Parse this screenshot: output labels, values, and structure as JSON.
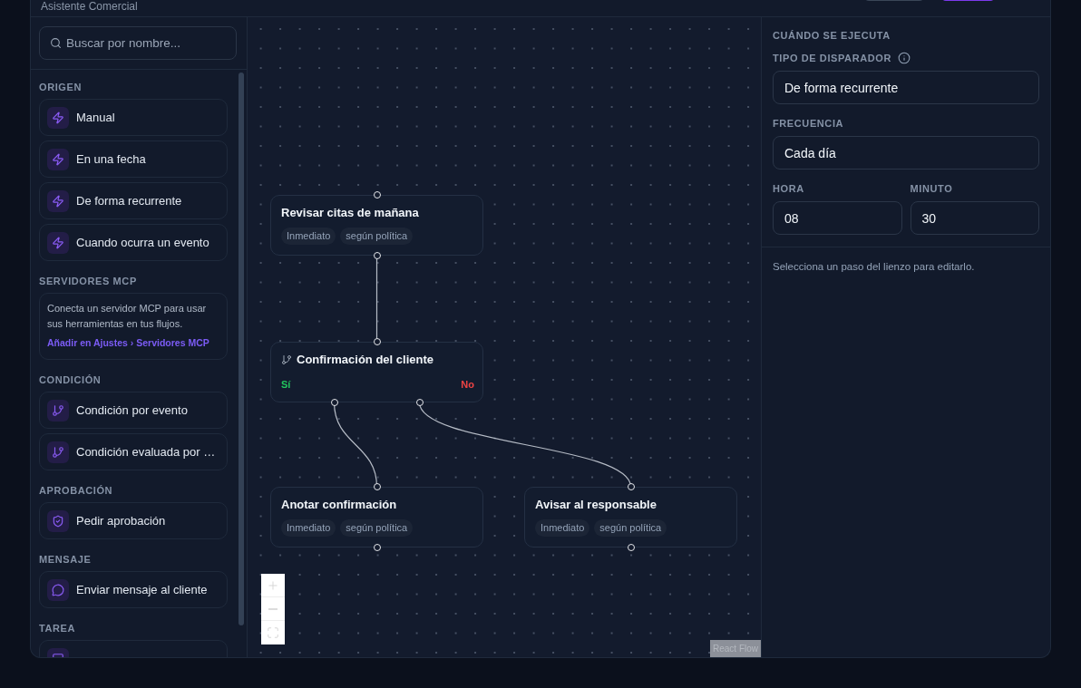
{
  "header": {
    "subtitle": "Asistente Comercial",
    "buttons": [
      {
        "kind": "secondary"
      },
      {
        "kind": "primary"
      }
    ]
  },
  "palette": {
    "search": {
      "placeholder": "Buscar por nombre..."
    },
    "sections": [
      {
        "title": "ORIGEN",
        "items": [
          {
            "kind": "trigger",
            "label": "Manual"
          },
          {
            "kind": "trigger",
            "label": "En una fecha"
          },
          {
            "kind": "trigger",
            "label": "De forma recurrente"
          },
          {
            "kind": "trigger",
            "label": "Cuando ocurra un evento"
          }
        ]
      },
      {
        "title": "SERVIDORES MCP",
        "notice": {
          "text": "Conecta un servidor MCP para usar sus herramientas en tus flujos.",
          "link": "Añadir en Ajustes › Servidores MCP"
        }
      },
      {
        "title": "CONDICIÓN",
        "items": [
          {
            "kind": "condition",
            "label": "Condición por evento"
          },
          {
            "kind": "condition",
            "label": "Condición evaluada por …"
          }
        ]
      },
      {
        "title": "APROBACIÓN",
        "items": [
          {
            "kind": "approval",
            "label": "Pedir aprobación"
          }
        ]
      },
      {
        "title": "MENSAJE",
        "items": [
          {
            "kind": "message",
            "label": "Enviar mensaje al cliente"
          }
        ]
      },
      {
        "title": "TAREA",
        "items": [
          {
            "kind": "task"
          }
        ]
      }
    ]
  },
  "canvas": {
    "steps": [
      {
        "kind": "action",
        "title": "Revisar citas de mañana",
        "tags": [
          "Inmediato",
          "según política"
        ]
      },
      {
        "kind": "condition",
        "title": "Confirmación del cliente",
        "branches": [
          {
            "label": "Sí",
            "color": "#22c55e",
            "step": {
              "kind": "action",
              "title": "Anotar confirmación",
              "tags": [
                "Inmediato",
                "según política"
              ]
            }
          },
          {
            "label": "No",
            "color": "#ef4444",
            "step": {
              "kind": "action",
              "title": "Avisar al responsable",
              "tags": [
                "Inmediato",
                "según política"
              ]
            }
          }
        ]
      }
    ],
    "controls": [
      {
        "kind": "zoom_in"
      },
      {
        "kind": "zoom_out"
      },
      {
        "kind": "fit_view"
      }
    ],
    "attribution": "React Flow"
  },
  "inspector": {
    "title": "CUÁNDO SE EJECUTA",
    "fields": [
      {
        "label": "TIPO DE DISPARADOR",
        "value": "De forma recurrente",
        "info": true
      },
      {
        "label": "FRECUENCIA",
        "value": "Cada día"
      }
    ],
    "pair": [
      {
        "label": "HORA",
        "value": "08"
      },
      {
        "label": "MINUTO",
        "value": "30"
      }
    ],
    "hint": "Selecciona un paso del lienzo para editarlo."
  }
}
